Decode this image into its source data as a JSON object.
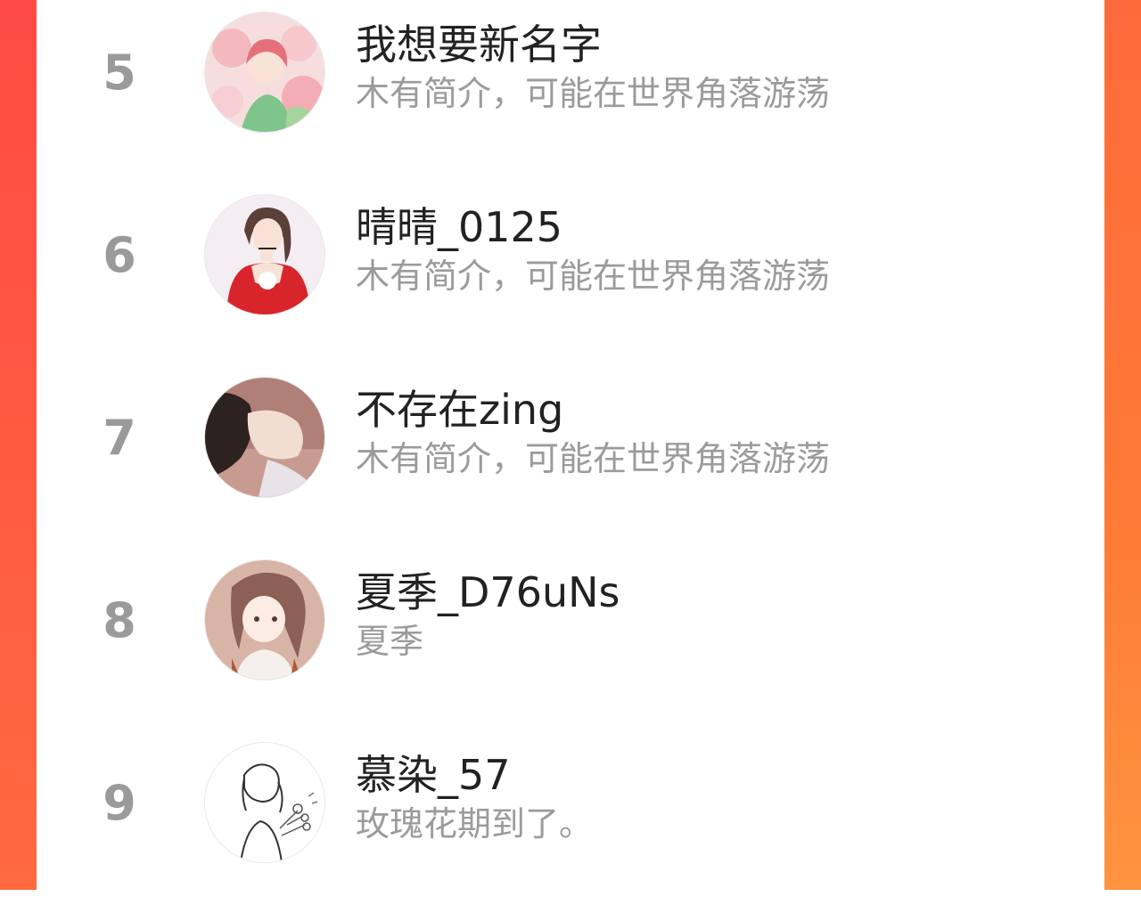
{
  "colors": {
    "accent_left": "#ff4a45",
    "accent_right": "#ff7b36",
    "rank_text": "#9a9a9a",
    "name_text": "#222222",
    "bio_text": "#9b9b9b"
  },
  "ranking": [
    {
      "rank": "5",
      "name": "我想要新名字",
      "bio": "木有简介，可能在世界角落游荡",
      "avatar": "avatar-anime-girl-flowers"
    },
    {
      "rank": "6",
      "name": "晴晴_0125",
      "bio": "木有简介，可能在世界角落游荡",
      "avatar": "avatar-illustrated-girl-red-dress"
    },
    {
      "rank": "7",
      "name": "不存在zing",
      "bio": "木有简介，可能在世界角落游荡",
      "avatar": "avatar-girl-profile-photo"
    },
    {
      "rank": "8",
      "name": "夏季_D76uNs",
      "bio": "夏季",
      "avatar": "avatar-anime-girl-braids"
    },
    {
      "rank": "9",
      "name": "慕染_57",
      "bio": "玫瑰花期到了。",
      "avatar": "avatar-sketch-girl-bouquet"
    }
  ]
}
